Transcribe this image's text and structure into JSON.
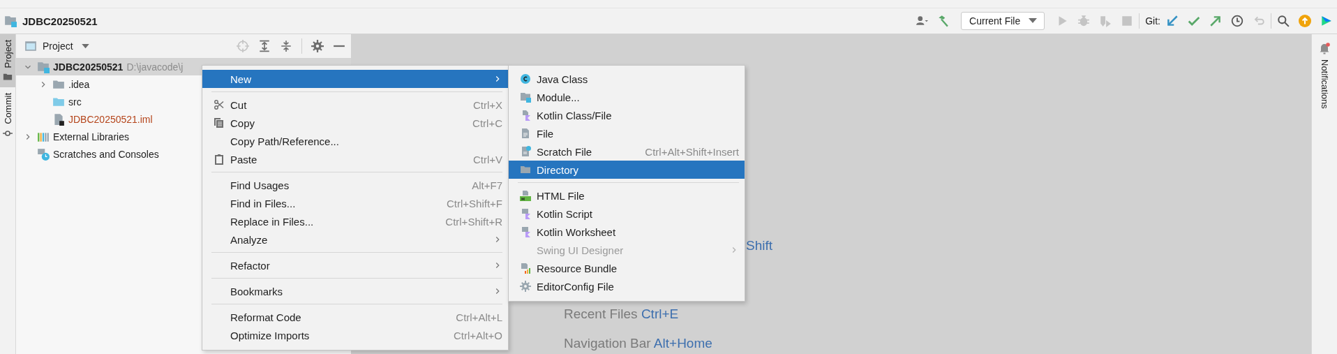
{
  "title_bar": {
    "project": "JDBC20250521",
    "run_config": "Current File",
    "git_label": "Git:"
  },
  "tool_stripe_left": [
    {
      "label": "Project",
      "selected": true
    },
    {
      "label": "Commit",
      "selected": false
    }
  ],
  "tool_stripe_right": [
    {
      "label": "Notifications"
    }
  ],
  "project_panel": {
    "title": "Project",
    "tree": [
      {
        "label": "JDBC20250521",
        "path": "D:\\javacode\\j",
        "kind": "module",
        "expanded": true,
        "selected": true,
        "children": [
          {
            "label": ".idea",
            "kind": "folder",
            "expanded": false,
            "selected": false
          },
          {
            "label": "src",
            "kind": "source",
            "selected": false
          },
          {
            "label": "JDBC20250521.iml",
            "kind": "iml",
            "selected": false
          }
        ]
      },
      {
        "label": "External Libraries",
        "kind": "libraries",
        "expanded": false,
        "selected": false
      },
      {
        "label": "Scratches and Consoles",
        "kind": "scratches",
        "selected": false
      }
    ]
  },
  "editor_hints": [
    {
      "shortcut": "Shift"
    },
    {
      "label": "Recent Files",
      "shortcut": "Ctrl+E"
    },
    {
      "label": "Navigation Bar",
      "shortcut": "Alt+Home"
    }
  ],
  "context_menu": {
    "groups": [
      [
        {
          "label": "New",
          "selected": true,
          "submenu": true
        }
      ],
      [
        {
          "label": "Cut",
          "shortcut": "Ctrl+X",
          "selected": false
        },
        {
          "label": "Copy",
          "shortcut": "Ctrl+C",
          "selected": false
        },
        {
          "label": "Copy Path/Reference...",
          "selected": false
        },
        {
          "label": "Paste",
          "shortcut": "Ctrl+V",
          "selected": false
        }
      ],
      [
        {
          "label": "Find Usages",
          "shortcut": "Alt+F7",
          "selected": false
        },
        {
          "label": "Find in Files...",
          "shortcut": "Ctrl+Shift+F",
          "selected": false
        },
        {
          "label": "Replace in Files...",
          "shortcut": "Ctrl+Shift+R",
          "selected": false
        },
        {
          "label": "Analyze",
          "selected": false,
          "submenu": true
        }
      ],
      [
        {
          "label": "Refactor",
          "selected": false,
          "submenu": true
        }
      ],
      [
        {
          "label": "Bookmarks",
          "selected": false,
          "submenu": true
        }
      ],
      [
        {
          "label": "Reformat Code",
          "shortcut": "Ctrl+Alt+L",
          "selected": false
        },
        {
          "label": "Optimize Imports",
          "shortcut": "Ctrl+Alt+O",
          "selected": false
        }
      ]
    ]
  },
  "new_submenu": {
    "groups": [
      [
        {
          "label": "Java Class",
          "selected": false,
          "disabled": false
        },
        {
          "label": "Module...",
          "selected": false,
          "disabled": false
        },
        {
          "label": "Kotlin Class/File",
          "selected": false,
          "disabled": false
        },
        {
          "label": "File",
          "selected": false,
          "disabled": false
        },
        {
          "label": "Scratch File",
          "shortcut": "Ctrl+Alt+Shift+Insert",
          "selected": false,
          "disabled": false
        },
        {
          "label": "Directory",
          "selected": true,
          "disabled": false
        }
      ],
      [
        {
          "label": "HTML File",
          "selected": false,
          "disabled": false
        },
        {
          "label": "Kotlin Script",
          "selected": false,
          "disabled": false
        },
        {
          "label": "Kotlin Worksheet",
          "selected": false,
          "disabled": false
        },
        {
          "label": "Swing UI Designer",
          "selected": false,
          "disabled": true,
          "submenu": true
        },
        {
          "label": "Resource Bundle",
          "selected": false,
          "disabled": false
        },
        {
          "label": "EditorConfig File",
          "selected": false,
          "disabled": false
        }
      ]
    ]
  }
}
